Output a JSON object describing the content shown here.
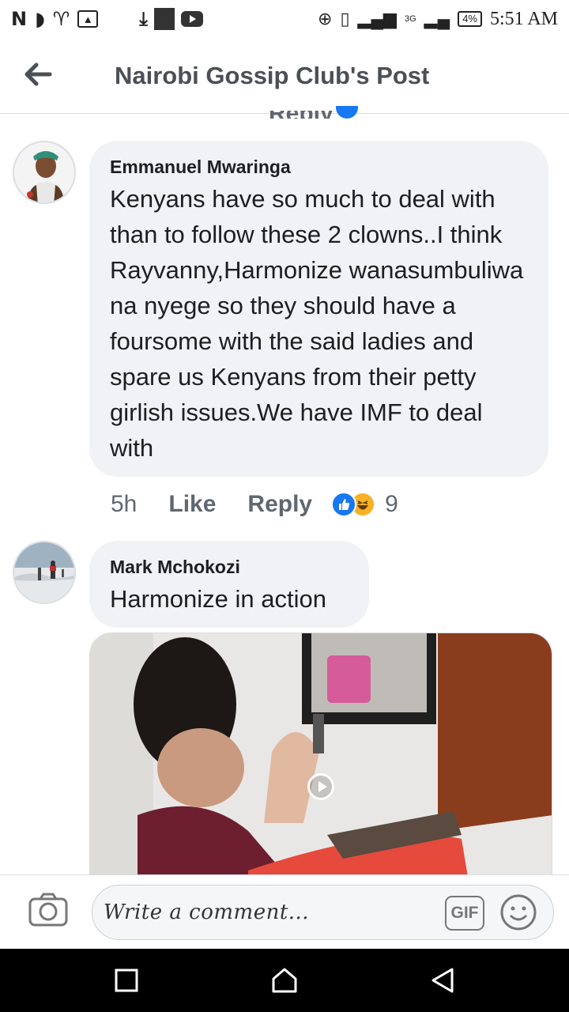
{
  "status_bar": {
    "left_glyphs": [
      "N",
      "◗",
      "♈"
    ],
    "battery": "4%",
    "network": "3G",
    "time": "5:51 AM"
  },
  "header": {
    "title": "Nairobi Gossip Club's Post",
    "back_icon": "arrow-left-icon"
  },
  "comments": [
    {
      "author": "Emmanuel Mwaringa",
      "text": "Kenyans have so much to deal with than to follow these 2 clowns..I think Rayvanny,Harmonize wanasumbuliwa na nyege so they should have a foursome with the said ladies and spare us Kenyans from their petty girlish issues.We have IMF to deal with",
      "time": "5h",
      "like_label": "Like",
      "reply_label": "Reply",
      "reaction_count": "9",
      "reactions": [
        "like",
        "haha"
      ]
    },
    {
      "author": "Mark Mchokozi",
      "text": "Harmonize in action",
      "media": "video"
    }
  ],
  "composer": {
    "placeholder": "Write a comment...",
    "gif_label": "GIF"
  },
  "colors": {
    "accent": "#1877f2",
    "bubble": "#f0f2f5",
    "muted_text": "#606770"
  }
}
